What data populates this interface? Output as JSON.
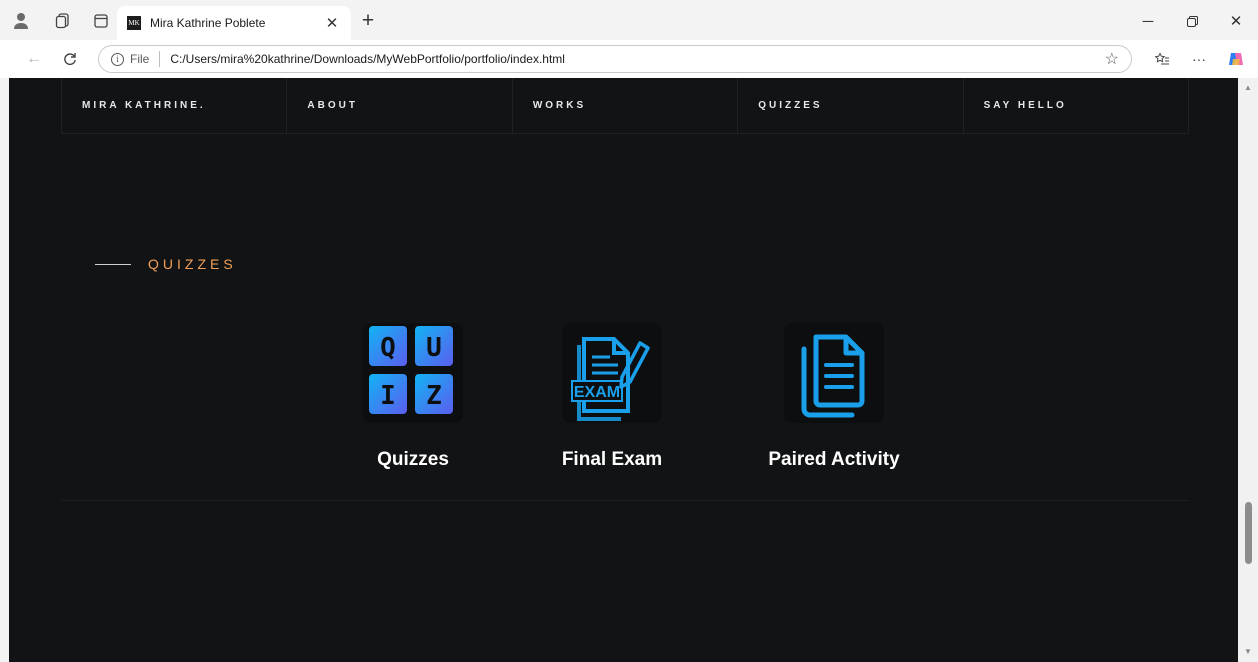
{
  "browser": {
    "tab": {
      "favicon_text": "MK",
      "title": "Mira Kathrine Poblete"
    },
    "address": {
      "scheme_label": "File",
      "url": "C:/Users/mira%20kathrine/Downloads/MyWebPortfolio/portfolio/index.html"
    }
  },
  "nav": {
    "items": [
      {
        "label": "MIRA KATHRINE."
      },
      {
        "label": "ABOUT"
      },
      {
        "label": "WORKS"
      },
      {
        "label": "QUIZZES"
      },
      {
        "label": "SAY HELLO"
      }
    ]
  },
  "section": {
    "title": "QUIZZES",
    "accent_color": "#f0a05a"
  },
  "cards": [
    {
      "label": "Quizzes",
      "icon": "quiz-tiles-icon",
      "letters": [
        "Q",
        "U",
        "I",
        "Z"
      ]
    },
    {
      "label": "Final Exam",
      "icon": "exam-document-icon",
      "badge": "EXAM"
    },
    {
      "label": "Paired Activity",
      "icon": "documents-icon"
    }
  ]
}
